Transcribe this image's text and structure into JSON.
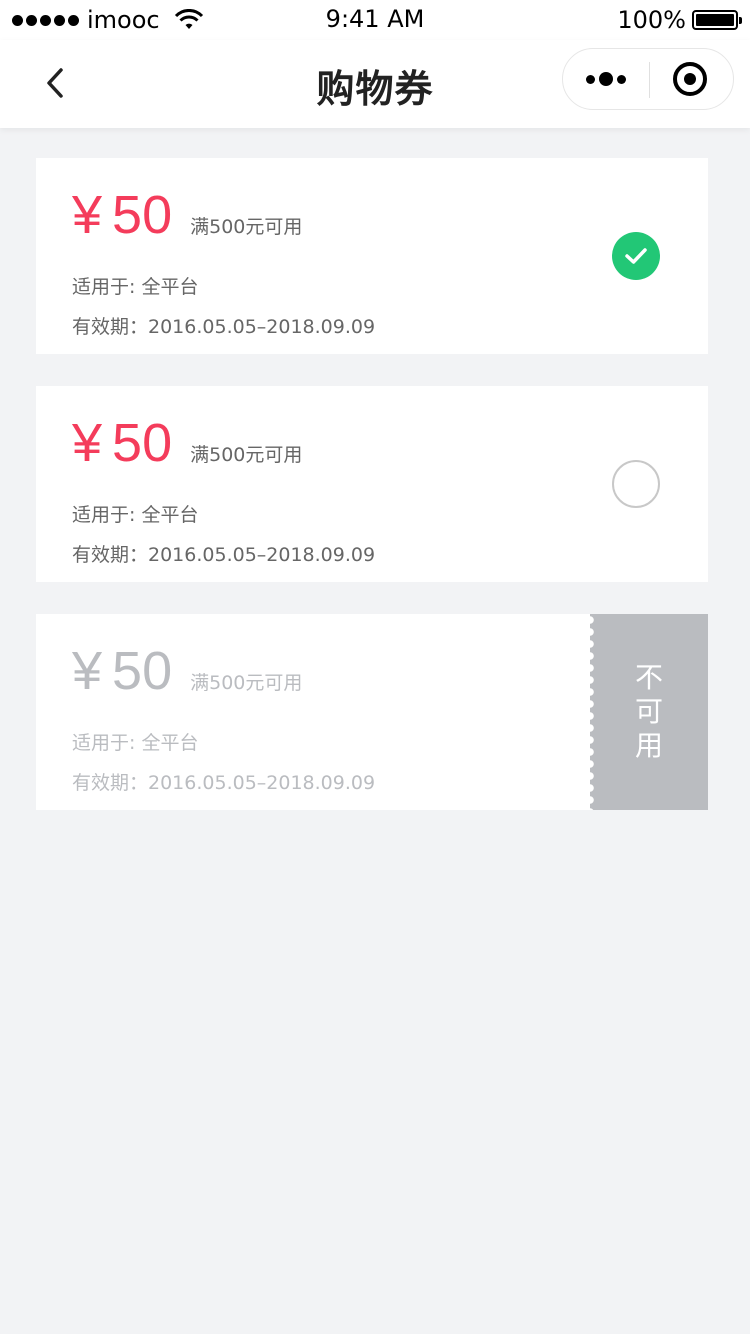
{
  "status_bar": {
    "carrier": "imooc",
    "time": "9:41 AM",
    "battery": "100%"
  },
  "nav": {
    "title": "购物券",
    "icons": [
      "back-chevron-icon",
      "more-dots-icon",
      "close-target-icon"
    ]
  },
  "coupons": [
    {
      "amount": "50",
      "currency": "¥",
      "condition": "满500元可用",
      "scope": "适用于: 全平台",
      "validity": "有效期：2016.05.05–2018.09.09",
      "state": "selected"
    },
    {
      "amount": "50",
      "currency": "¥",
      "condition": "满500元可用",
      "scope": "适用于: 全平台",
      "validity": "有效期：2016.05.05–2018.09.09",
      "state": "unselected"
    },
    {
      "amount": "50",
      "currency": "¥",
      "condition": "满500元可用",
      "scope": "适用于: 全平台",
      "validity": "有效期：2016.05.05–2018.09.09",
      "state": "unavailable",
      "unavailable_label": "不可用"
    }
  ],
  "colors": {
    "accent_red": "#f43c5b",
    "check_green": "#22c776",
    "disabled_gray": "#babcc0",
    "background": "#f2f3f5"
  }
}
